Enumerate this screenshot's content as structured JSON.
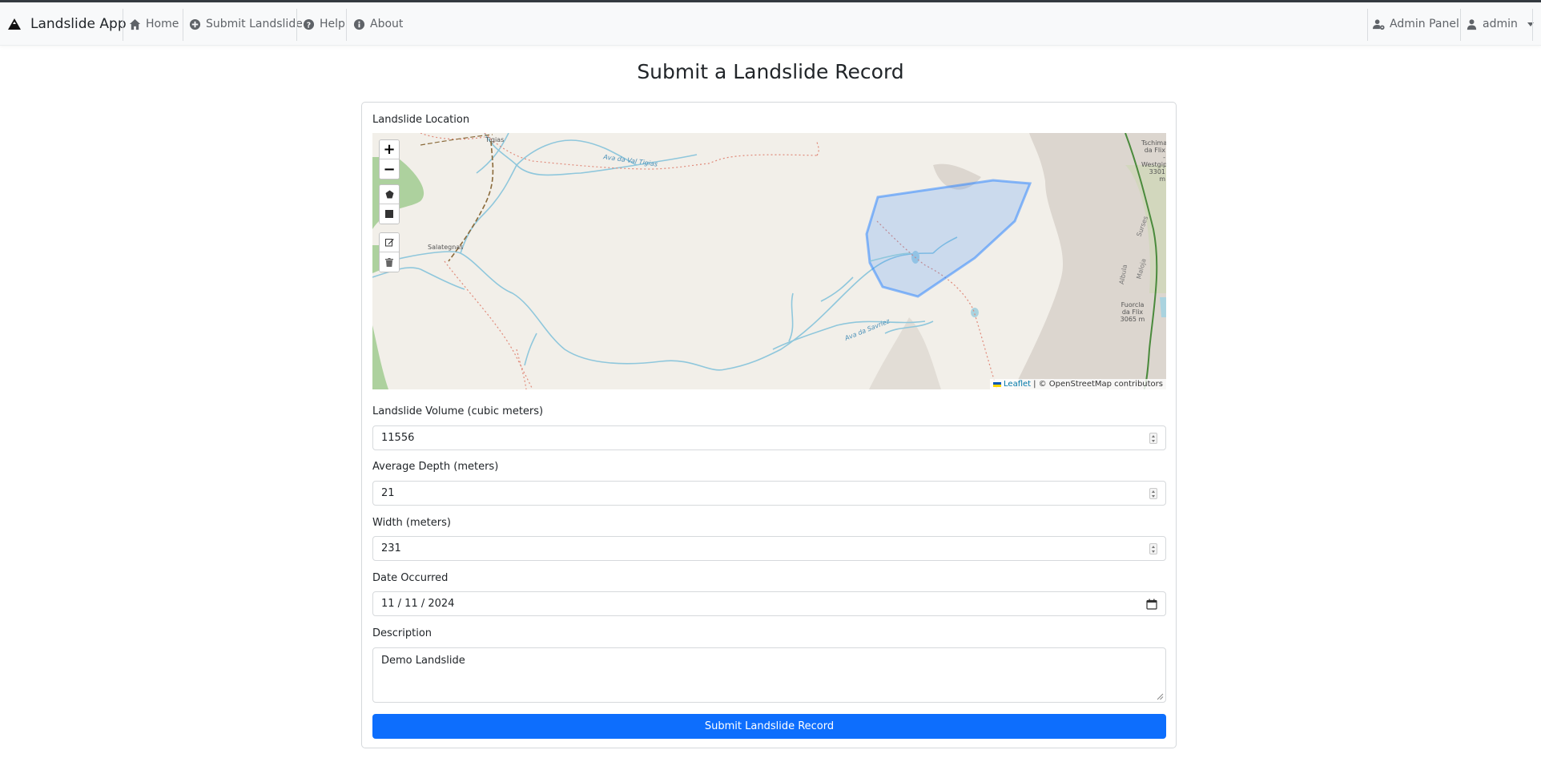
{
  "navbar": {
    "brand": "Landslide App",
    "items": [
      {
        "label": "Home",
        "icon": "home-icon"
      },
      {
        "label": "Submit Landslide",
        "icon": "plus-circle-icon"
      },
      {
        "label": "Help",
        "icon": "question-circle-icon"
      },
      {
        "label": "About",
        "icon": "info-circle-icon"
      }
    ],
    "admin_panel": "Admin Panel",
    "user": "admin"
  },
  "page": {
    "title": "Submit a Landslide Record"
  },
  "form": {
    "location_label": "Landslide Location",
    "map": {
      "zoom_in": "+",
      "zoom_out": "−",
      "attribution_leaflet": "Leaflet",
      "attribution_rest": "| © OpenStreetMap contributors",
      "place_labels": {
        "tigias": "Tigias",
        "salategnas": "Salategnas",
        "river1": "Ava da Val Tigias",
        "river2": "Ava da Savriez",
        "peak1_a": "Tschima",
        "peak1_b": "da Flix -",
        "peak1_c": "Westgipfel",
        "peak1_d": "3301 m",
        "peak2_a": "Fuorcla",
        "peak2_b": "da Flix",
        "peak2_c": "3065 m",
        "trail1": "Surses",
        "trail2": "Albula",
        "trail3": "Maloja"
      }
    },
    "volume_label": "Landslide Volume (cubic meters)",
    "volume_value": "11556",
    "depth_label": "Average Depth (meters)",
    "depth_value": "21",
    "width_label": "Width (meters)",
    "width_value": "231",
    "date_label": "Date Occurred",
    "date_value": "11 / 11 / 2024",
    "description_label": "Description",
    "description_value": "Demo Landslide",
    "submit_label": "Submit Landslide Record"
  },
  "colors": {
    "primary": "#0d6efd",
    "polygon": "#3388ff",
    "map_bg": "#f2efe9",
    "water": "#8fc7dc"
  }
}
